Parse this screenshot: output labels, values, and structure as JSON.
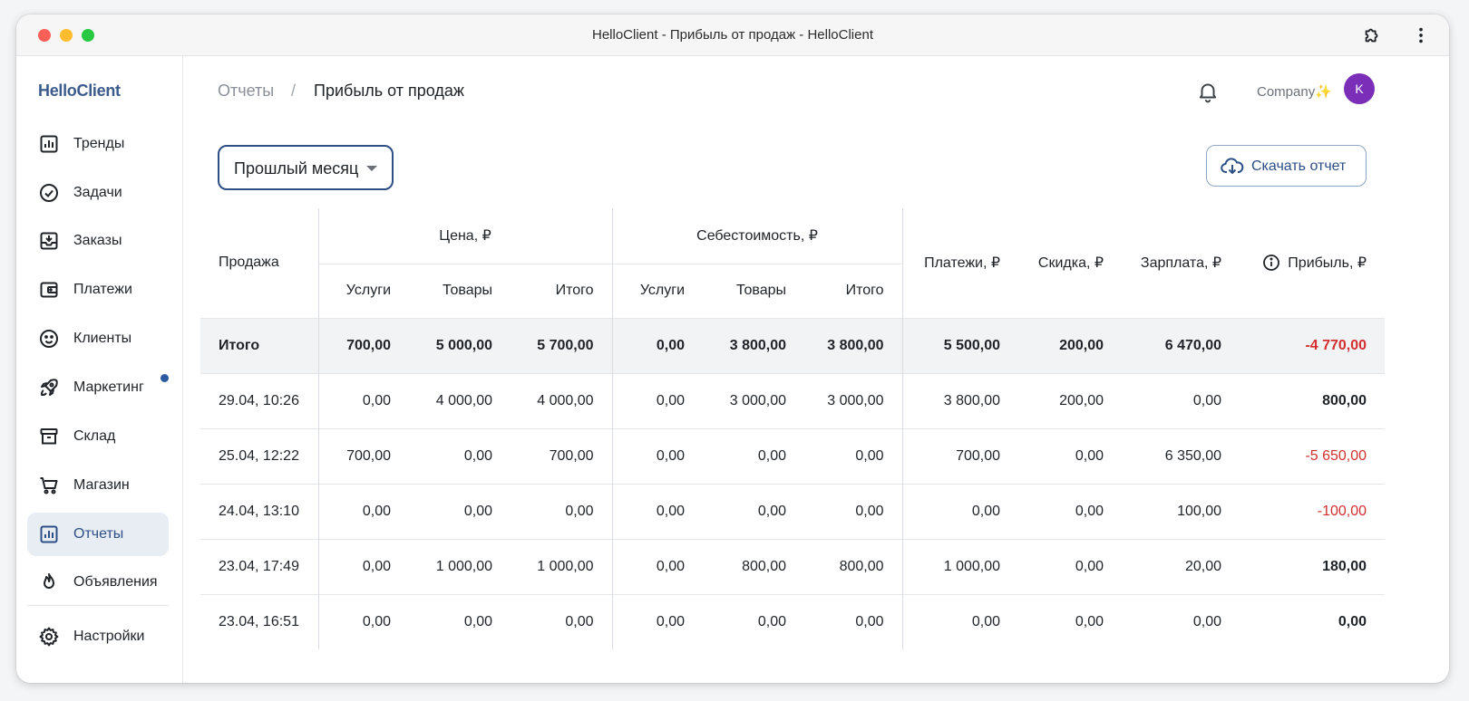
{
  "window": {
    "title": "HelloClient - Прибыль от продаж - HelloClient"
  },
  "sidebar": {
    "brand": "HelloClient",
    "items": [
      {
        "label": "Тренды",
        "icon": "chart-icon"
      },
      {
        "label": "Задачи",
        "icon": "check-circle-icon"
      },
      {
        "label": "Заказы",
        "icon": "inbox-icon"
      },
      {
        "label": "Платежи",
        "icon": "wallet-icon"
      },
      {
        "label": "Клиенты",
        "icon": "smiley-icon"
      },
      {
        "label": "Маркетинг",
        "icon": "rocket-icon",
        "badge": true
      },
      {
        "label": "Склад",
        "icon": "archive-icon"
      },
      {
        "label": "Магазин",
        "icon": "cart-icon"
      },
      {
        "label": "Отчеты",
        "icon": "report-icon",
        "active": true
      },
      {
        "label": "Объявления",
        "icon": "flame-icon"
      },
      {
        "label": "Настройки",
        "icon": "gear-icon"
      }
    ]
  },
  "header": {
    "breadcrumb_root": "Отчеты",
    "breadcrumb_sep": "/",
    "breadcrumb_current": "Прибыль от продаж",
    "company": "Company✨",
    "avatar_letter": "K"
  },
  "toolbar": {
    "period": "Прошлый месяц",
    "download_label": "Скачать отчет"
  },
  "table": {
    "col_sale": "Продажа",
    "group_price": "Цена, ₽",
    "group_cost": "Себестоимость, ₽",
    "sub_services": "Услуги",
    "sub_goods": "Товары",
    "sub_total": "Итого",
    "col_payments": "Платежи, ₽",
    "col_discount": "Скидка, ₽",
    "col_salary": "Зарплата, ₽",
    "col_profit": "Прибыль, ₽",
    "total": {
      "label": "Итого",
      "cells": [
        "700,00",
        "5 000,00",
        "5 700,00",
        "0,00",
        "3 800,00",
        "3 800,00",
        "5 500,00",
        "200,00",
        "6 470,00",
        "-4 770,00"
      ]
    },
    "rows": [
      {
        "date": "29.04, 10:26",
        "cells": [
          "0,00",
          "4 000,00",
          "4 000,00",
          "0,00",
          "3 000,00",
          "3 000,00",
          "3 800,00",
          "200,00",
          "0,00",
          "800,00"
        ]
      },
      {
        "date": "25.04, 12:22",
        "cells": [
          "700,00",
          "0,00",
          "700,00",
          "0,00",
          "0,00",
          "0,00",
          "700,00",
          "0,00",
          "6 350,00",
          "-5 650,00"
        ]
      },
      {
        "date": "24.04, 13:10",
        "cells": [
          "0,00",
          "0,00",
          "0,00",
          "0,00",
          "0,00",
          "0,00",
          "0,00",
          "0,00",
          "100,00",
          "-100,00"
        ]
      },
      {
        "date": "23.04, 17:49",
        "cells": [
          "0,00",
          "1 000,00",
          "1 000,00",
          "0,00",
          "800,00",
          "800,00",
          "1 000,00",
          "0,00",
          "20,00",
          "180,00"
        ]
      },
      {
        "date": "23.04, 16:51",
        "cells": [
          "0,00",
          "0,00",
          "0,00",
          "0,00",
          "0,00",
          "0,00",
          "0,00",
          "0,00",
          "0,00",
          "0,00"
        ]
      }
    ]
  },
  "colors": {
    "accent": "#2c4f86",
    "brand": "#3b5b8c",
    "negative": "#d32f2f",
    "active_bg": "#e8edf4",
    "avatar": "#7b2fb8"
  }
}
